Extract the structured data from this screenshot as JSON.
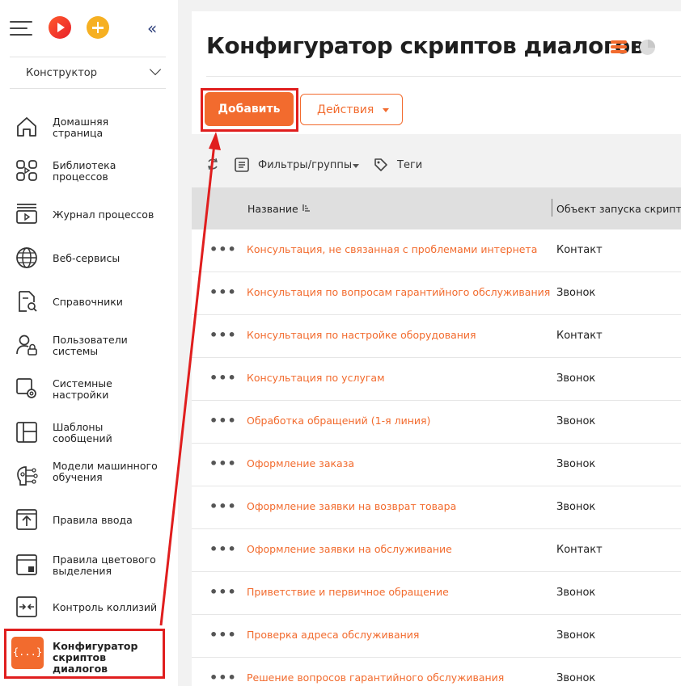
{
  "sidebar": {
    "section_select": "Конструктор",
    "items": [
      {
        "label": "Домашняя страница",
        "icon": "home-icon"
      },
      {
        "label": "Библиотека процессов",
        "icon": "process-library-icon"
      },
      {
        "label": "Журнал процессов",
        "icon": "process-log-icon"
      },
      {
        "label": "Веб-сервисы",
        "icon": "globe-icon"
      },
      {
        "label": "Справочники",
        "icon": "lookup-icon"
      },
      {
        "label": "Пользователи системы",
        "icon": "user-lock-icon"
      },
      {
        "label": "Системные настройки",
        "icon": "settings-icon"
      },
      {
        "label": "Шаблоны сообщений",
        "icon": "templates-icon"
      },
      {
        "label": "Модели машинного обучения",
        "icon": "ml-brain-icon"
      },
      {
        "label": "Правила ввода",
        "icon": "input-rules-icon"
      },
      {
        "label": "Правила цветового выделения",
        "icon": "color-rules-icon"
      },
      {
        "label": "Контроль коллизий",
        "icon": "collision-icon"
      },
      {
        "label": "Конфигуратор скриптов диалогов",
        "icon": "script-config-icon",
        "active": true
      }
    ],
    "active_icon_glyph": "{...}"
  },
  "main": {
    "title": "Конфигуратор скриптов диалогов",
    "add_label": "Добавить",
    "actions_label": "Действия",
    "filters_label": "Фильтры/группы",
    "tags_label": "Теги",
    "columns": [
      "Название",
      "Объект запуска скрипта"
    ],
    "rows": [
      {
        "name": "Консультация, не связанная с проблемами интернета",
        "object": "Контакт"
      },
      {
        "name": "Консультация по вопросам гарантийного обслуживания",
        "object": "Звонок"
      },
      {
        "name": "Консультация по настройке оборудования",
        "object": "Контакт"
      },
      {
        "name": "Консультация по услугам",
        "object": "Звонок"
      },
      {
        "name": "Обработка обращений (1-я линия)",
        "object": "Звонок"
      },
      {
        "name": "Оформление заказа",
        "object": "Звонок"
      },
      {
        "name": "Оформление заявки на возврат товара",
        "object": "Звонок"
      },
      {
        "name": "Оформление заявки на обслуживание",
        "object": "Контакт"
      },
      {
        "name": "Приветствие и первичное обращение",
        "object": "Звонок"
      },
      {
        "name": "Проверка адреса обслуживания",
        "object": "Звонок"
      },
      {
        "name": "Решение вопросов гарантийного обслуживания",
        "object": "Звонок"
      }
    ],
    "row_menu_glyph": "•••"
  },
  "colors": {
    "accent": "#f26b2e",
    "highlight": "#e01e1e"
  }
}
